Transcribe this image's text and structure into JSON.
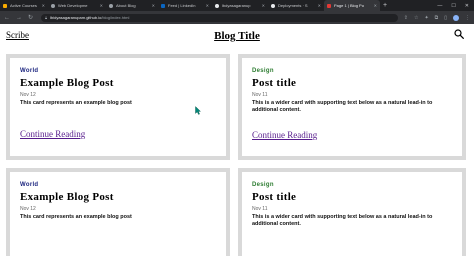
{
  "browser": {
    "tabs": [
      {
        "label": "Active Courses",
        "color": "#f9ab00"
      },
      {
        "label": "Web Developme",
        "color": "#9aa0a6"
      },
      {
        "label": "About Blog",
        "color": "#9aa0a6"
      },
      {
        "label": "Feed | LinkedIn",
        "color": "#0a66c2"
      },
      {
        "label": "lbdyasagaranup",
        "color": "#e8eaed"
      },
      {
        "label": "Deployments · S",
        "color": "#e8eaed"
      },
      {
        "label": "Page 1 | Blog Po",
        "color": "#e53935",
        "active": true
      }
    ],
    "new_tab": "+",
    "url_host": "lbidyasagaranupam.github.io",
    "url_path": "/blog/index.html"
  },
  "page": {
    "subscribe": "Scribe",
    "title": "Blog Title"
  },
  "cards": [
    {
      "category": "World",
      "title": "Example Blog Post",
      "date": "Nov 12",
      "text": "This card represents an example blog post",
      "link": "Continue Reading"
    },
    {
      "category": "Design",
      "title": "Post title",
      "date": "Nov 11",
      "text": "This is a wider card with supporting text below as a natural lead-in to additional content.",
      "link": "Continue Reading"
    },
    {
      "category": "World",
      "title": "Example Blog Post",
      "date": "Nov 12",
      "text": "This card represents an example blog post",
      "link": ""
    },
    {
      "category": "Design",
      "title": "Post title",
      "date": "Nov 11",
      "text": "This is a wider card with supporting text below as a natural lead-in to additional content.",
      "link": ""
    }
  ]
}
